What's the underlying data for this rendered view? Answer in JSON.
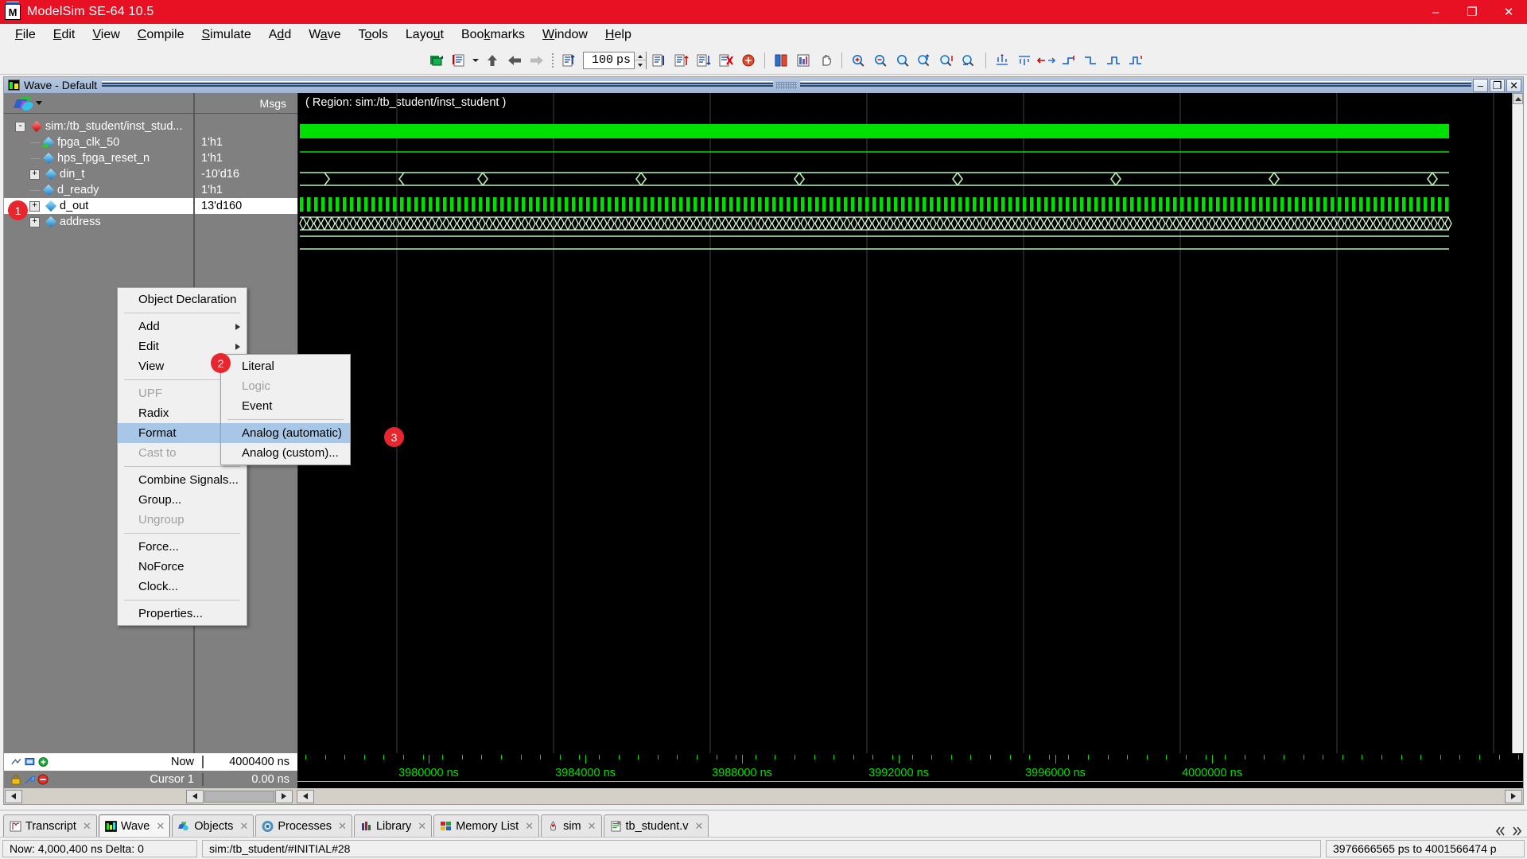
{
  "window": {
    "title": "ModelSim SE-64 10.5",
    "logo_letter": "M",
    "minimize": "–",
    "maximize": "❐",
    "close": "✕"
  },
  "menubar": [
    {
      "label": "File"
    },
    {
      "label": "Edit"
    },
    {
      "label": "View"
    },
    {
      "label": "Compile"
    },
    {
      "label": "Simulate"
    },
    {
      "label": "Add"
    },
    {
      "label": "Wave"
    },
    {
      "label": "Tools"
    },
    {
      "label": "Layout"
    },
    {
      "label": "Bookmarks"
    },
    {
      "label": "Window"
    },
    {
      "label": "Help"
    }
  ],
  "toolbar": {
    "run_time_value": "100",
    "run_time_unit": "ps",
    "icons": [
      "compile-icon",
      "simulate-icon",
      "step-up-icon",
      "step-back-icon",
      "step-forward-icon",
      "run-icon",
      "run-continue-icon",
      "run-all-icon",
      "break-icon",
      "restart-icon",
      "stop-icon",
      "memory-icon",
      "hand-icon",
      "zoom-in-icon",
      "zoom-out-icon",
      "zoom-full-icon",
      "zoom-range-icon",
      "zoom-cursor-icon",
      "zoom-last-icon",
      "wave-edit-1-icon",
      "wave-edit-2-icon",
      "wave-edit-3-icon",
      "wave-edit-4-icon",
      "wave-edit-5-icon",
      "wave-edit-6-icon",
      "wave-edit-7-icon"
    ]
  },
  "wave_window": {
    "title": "Wave - Default",
    "icon": "wave-window-icon",
    "minimize": "–",
    "restore": "❐",
    "close": "✕",
    "pane_header": {
      "layer_icon": "layers-icon",
      "msgs_label": "Msgs"
    },
    "region_label": "( Region: sim:/tb_student/inst_student )",
    "signals": [
      {
        "name": "sim:/tb_student/inst_stud...",
        "value": "",
        "icon": "red-diamond-icon",
        "expander": "-",
        "depth": 0,
        "selected": false
      },
      {
        "name": "fpga_clk_50",
        "value": "1'h1",
        "icon": "clock-diamond-icon",
        "expander": "",
        "depth": 1,
        "selected": false
      },
      {
        "name": "hps_fpga_reset_n",
        "value": "1'h1",
        "icon": "blue-diamond-icon",
        "expander": "",
        "depth": 1,
        "selected": false
      },
      {
        "name": "din_t",
        "value": "-10'd16",
        "icon": "blue-diamond-icon",
        "expander": "+",
        "depth": 1,
        "selected": false
      },
      {
        "name": "d_ready",
        "value": "1'h1",
        "icon": "blue-diamond-icon",
        "expander": "",
        "depth": 1,
        "selected": false
      },
      {
        "name": "d_out",
        "value": "13'd160",
        "icon": "blue-diamond-icon",
        "expander": "+",
        "depth": 1,
        "selected": true
      },
      {
        "name": "address",
        "value": "",
        "icon": "blue-diamond-icon",
        "expander": "+",
        "depth": 1,
        "selected": false
      }
    ],
    "cursor_panel": {
      "now_label": "Now",
      "now_value": "4000400 ns",
      "cursor_label": "Cursor 1",
      "cursor_value": "0.00 ns"
    },
    "timeline": {
      "labels": [
        "3980000 ns",
        "3984000 ns",
        "3988000 ns",
        "3992000 ns",
        "3996000 ns",
        "4000000 ns"
      ],
      "unit": "ns"
    }
  },
  "context_menu": {
    "items": [
      {
        "label": "Object Declaration",
        "type": "item"
      },
      {
        "type": "separator"
      },
      {
        "label": "Add",
        "type": "submenu"
      },
      {
        "label": "Edit",
        "type": "submenu"
      },
      {
        "label": "View",
        "type": "submenu"
      },
      {
        "type": "separator"
      },
      {
        "label": "UPF",
        "type": "submenu",
        "disabled": true
      },
      {
        "label": "Radix",
        "type": "submenu"
      },
      {
        "label": "Format",
        "type": "submenu",
        "highlighted": true
      },
      {
        "label": "Cast to",
        "type": "submenu",
        "disabled": true
      },
      {
        "type": "separator"
      },
      {
        "label": "Combine Signals...",
        "type": "item"
      },
      {
        "label": "Group...",
        "type": "item"
      },
      {
        "label": "Ungroup",
        "type": "item",
        "disabled": true
      },
      {
        "type": "separator"
      },
      {
        "label": "Force...",
        "type": "item"
      },
      {
        "label": "NoForce",
        "type": "item"
      },
      {
        "label": "Clock...",
        "type": "item"
      },
      {
        "type": "separator"
      },
      {
        "label": "Properties...",
        "type": "item"
      }
    ]
  },
  "format_submenu": {
    "items": [
      {
        "label": "Literal",
        "type": "item"
      },
      {
        "label": "Logic",
        "type": "item",
        "disabled": true
      },
      {
        "label": "Event",
        "type": "item"
      },
      {
        "type": "separator"
      },
      {
        "label": "Analog (automatic)",
        "type": "item",
        "highlighted": true
      },
      {
        "label": "Analog (custom)...",
        "type": "item"
      }
    ]
  },
  "badges": [
    {
      "number": "1",
      "target": "signal-d-out"
    },
    {
      "number": "2",
      "target": "menu-format"
    },
    {
      "number": "3",
      "target": "menu-analog-automatic"
    }
  ],
  "tabs": [
    {
      "label": "Transcript",
      "icon": "transcript-icon",
      "active": false
    },
    {
      "label": "Wave",
      "icon": "wave-tab-icon",
      "active": true
    },
    {
      "label": "Objects",
      "icon": "objects-icon",
      "active": false
    },
    {
      "label": "Processes",
      "icon": "processes-icon",
      "active": false
    },
    {
      "label": "Library",
      "icon": "library-icon",
      "active": false
    },
    {
      "label": "Memory List",
      "icon": "memory-icon",
      "active": false
    },
    {
      "label": "sim",
      "icon": "sim-icon",
      "active": false
    },
    {
      "label": "tb_student.v",
      "icon": "source-file-icon",
      "active": false
    }
  ],
  "statusbar": {
    "now_delta": "Now: 4,000,400 ns  Delta: 0",
    "context": "sim:/tb_student/#INITIAL#28",
    "range": "3976666565 ps to 4001566474 p"
  },
  "colors": {
    "titlebar": "#e81123",
    "wave_green": "#00e000",
    "wave_bus": "#b8f0b8",
    "badge_red": "#e8262d",
    "menu_highlight": "#a8c6e5"
  }
}
